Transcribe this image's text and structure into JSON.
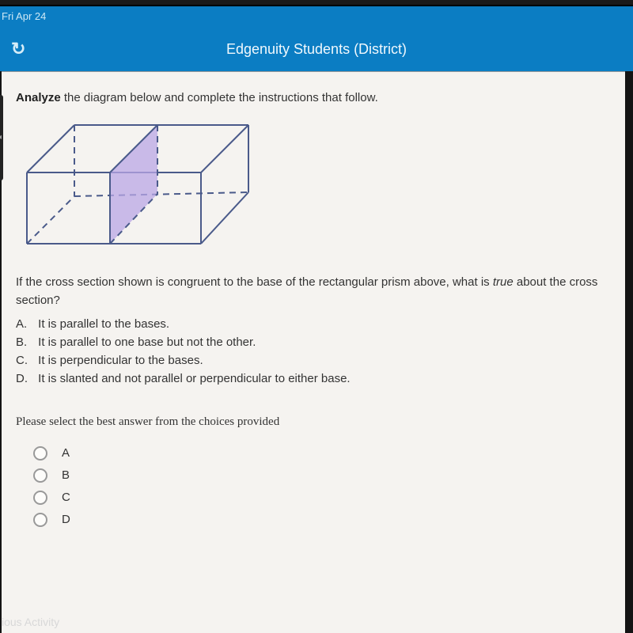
{
  "status": {
    "date": "Fri Apr 24"
  },
  "nav": {
    "redo_icon": "↻",
    "title": "Edgenuity Students (District)"
  },
  "instruction": {
    "strong": "Analyze",
    "rest": " the diagram below and complete the instructions that follow."
  },
  "question": {
    "line1_pre": "If the cross section shown is congruent to the base of the rectangular prism above, what is ",
    "line1_em": "true",
    "line1_post": " about the cross",
    "line2": "section?"
  },
  "options": {
    "a_letter": "A.",
    "a_text": "It is parallel to the bases.",
    "b_letter": "B.",
    "b_text": "It is parallel to one base but not the other.",
    "c_letter": "C.",
    "c_text": "It is perpendicular to the bases.",
    "d_letter": "D.",
    "d_text": "It is slanted and not parallel or perpendicular to either base."
  },
  "select_prompt": "Please select the best answer from the choices provided",
  "answers": {
    "a": "A",
    "b": "B",
    "c": "C",
    "d": "D"
  },
  "footer": {
    "prev": "ious Activity"
  },
  "side_arrow": "◂"
}
